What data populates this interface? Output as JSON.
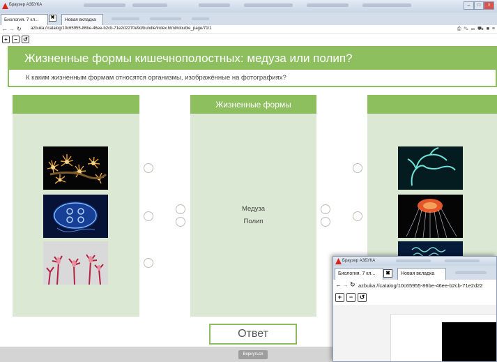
{
  "browser": {
    "window_title": "Браузер АЗБУКА",
    "tabs": [
      {
        "label": "Биология. 7 кл..."
      },
      {
        "label": "Новая вкладка"
      }
    ],
    "close_tab_glyph": "✖",
    "url": "azbuka://catalog/10c65955-86be-46ee-b2cb-71e2d2270e9d/bundle/index.html#double_page/71/1",
    "nav": {
      "back": "←",
      "forward": "→",
      "reload": "↻"
    },
    "zoom": {
      "zoom_in": "+",
      "zoom_out": "−",
      "reset": "↺"
    },
    "toolbar_icons": [
      "print-icon",
      "chat-icon",
      "monitor-icon",
      "cart-icon",
      "folder-icon",
      "menu-icon"
    ]
  },
  "exercise": {
    "title": "Жизненные формы кишечнополостных: медуза или полип?",
    "subtitle": "К каким жизненным формам относятся организмы, изображённые на фотографиях?",
    "center_panel": {
      "heading": "Жизненные формы",
      "options": [
        "Медуза",
        "Полип"
      ]
    },
    "answer_button": "Ответ",
    "back_button": "Вернуться"
  },
  "second_window": {
    "window_title": "Браузер АЗБУКА",
    "tabs": [
      {
        "label": "Биология. 7 кл..."
      },
      {
        "label": "Новая вкладка"
      }
    ],
    "url": "azbuka://catalog/10c65955-86be-46ee-b2cb-71e2d22"
  },
  "colors": {
    "accent_green": "#8dbf5f",
    "panel_green": "#dbe9d4"
  }
}
